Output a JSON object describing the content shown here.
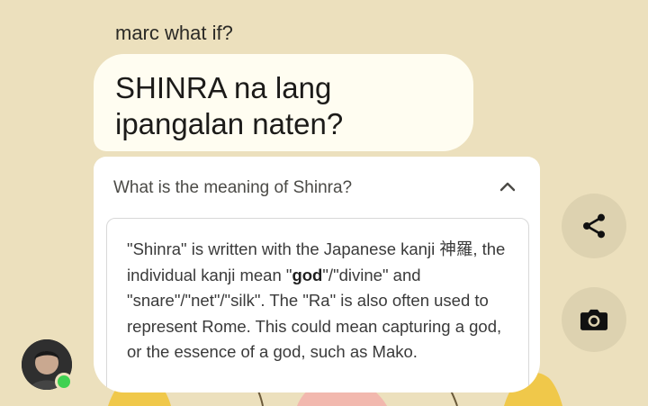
{
  "message": {
    "sender": "marc what if?",
    "text": "SHINRA na lang ipangalan naten?"
  },
  "search_card": {
    "question": "What is the meaning of Shinra?",
    "answer_parts": {
      "p1": "\"Shinra\" is written with the Japanese kanji 神羅, the individual kanji mean \"",
      "bold": "god",
      "p2": "\"/\"divine\" and \"snare\"/\"net\"/\"silk\". The \"Ra\" is also often used to represent Rome. This could mean capturing a god, or the essence of a god, such as Mako."
    }
  },
  "actions": {
    "share_icon": "share-icon",
    "camera_icon": "camera-icon"
  },
  "colors": {
    "background": "#ece0bd",
    "bubble": "#fffdf1",
    "fab": "#ddd2b0",
    "online": "#3fd151"
  }
}
